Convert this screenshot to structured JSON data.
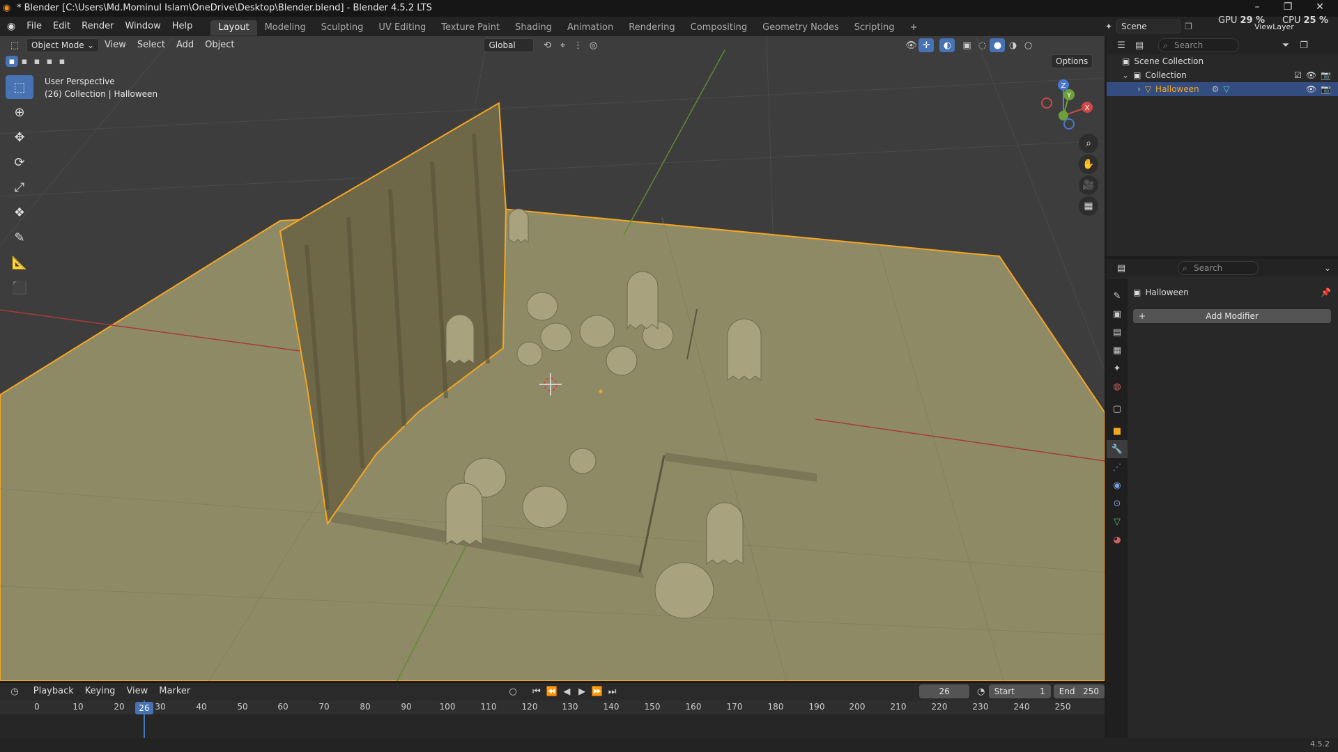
{
  "window": {
    "title": "* Blender [C:\\Users\\Md.Mominul Islam\\OneDrive\\Desktop\\Blender.blend] - Blender 4.5.2 LTS"
  },
  "menu": [
    "File",
    "Edit",
    "Render",
    "Window",
    "Help"
  ],
  "workspaces": [
    "Layout",
    "Modeling",
    "Sculpting",
    "UV Editing",
    "Texture Paint",
    "Shading",
    "Animation",
    "Rendering",
    "Compositing",
    "Geometry Nodes",
    "Scripting"
  ],
  "topright": {
    "scene": "Scene",
    "gpu_label": "GPU",
    "gpu_value": "29 %",
    "cpu_label": "CPU",
    "cpu_value": "25 %",
    "view_layer": "ViewLayer"
  },
  "viewport": {
    "mode": "Object Mode",
    "menus": [
      "View",
      "Select",
      "Add",
      "Object"
    ],
    "orientation": "Global",
    "options": "Options",
    "info_line1": "User Perspective",
    "info_line2": "(26) Collection | Halloween",
    "gizmo": {
      "x": "X",
      "y": "Y",
      "z": "Z"
    }
  },
  "timeline": {
    "menus": [
      "Playback",
      "Keying",
      "View",
      "Marker"
    ],
    "current_frame": "26",
    "start_label": "Start",
    "start": "1",
    "end_label": "End",
    "end": "250",
    "ticks": [
      "0",
      "10",
      "20",
      "30",
      "40",
      "50",
      "60",
      "70",
      "80",
      "90",
      "100",
      "110",
      "120",
      "130",
      "140",
      "150",
      "160",
      "170",
      "180",
      "190",
      "200",
      "210",
      "220",
      "230",
      "240",
      "250"
    ]
  },
  "outliner": {
    "search": "Search",
    "scene_collection": "Scene Collection",
    "collection": "Collection",
    "object": "Halloween"
  },
  "properties": {
    "search": "Search",
    "object_name": "Halloween",
    "add_modifier": "Add Modifier"
  },
  "status": {
    "version": "4.5.2"
  },
  "colors": {
    "accent": "#4772b3",
    "selection_outline": "#f5a623",
    "ground": "#8f8a66"
  }
}
